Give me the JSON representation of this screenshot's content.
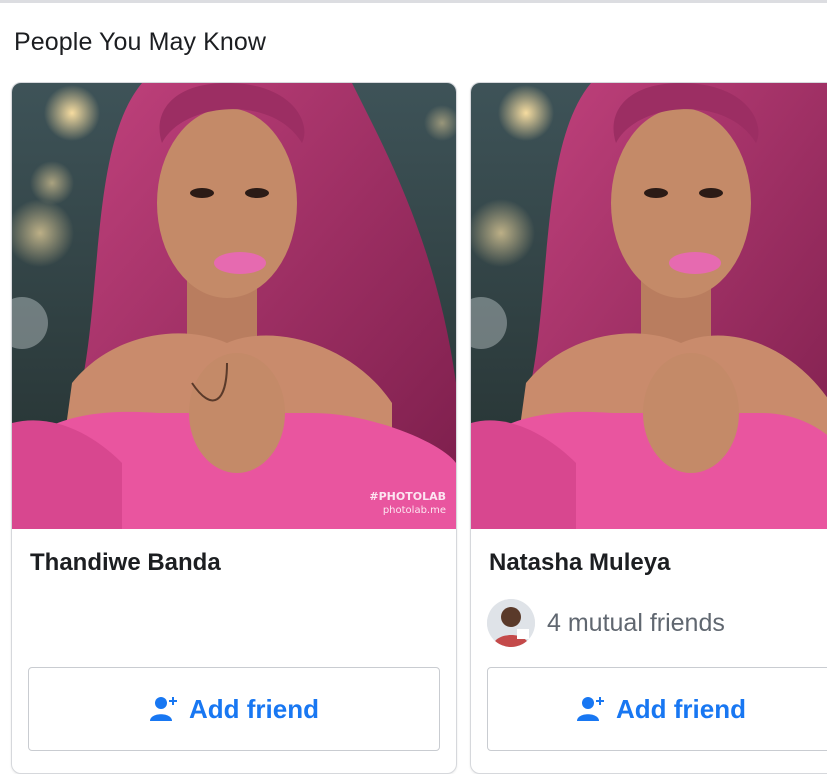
{
  "section": {
    "title": "People You May Know"
  },
  "colors": {
    "accent": "#1877f2",
    "text": "#1c1e21",
    "muted": "#606770",
    "hair": "#b0306e",
    "top": "#ee5aa8"
  },
  "cards": [
    {
      "name": "Thandiwe Banda",
      "watermark_line1": "#PHOTOLAB",
      "watermark_line2": "photolab.me",
      "button_label": "Add friend",
      "icon": "add-friend-icon"
    },
    {
      "name": "Natasha Muleya",
      "mutual_friends": "4 mutual friends",
      "button_label": "Add friend",
      "icon": "add-friend-icon"
    }
  ]
}
